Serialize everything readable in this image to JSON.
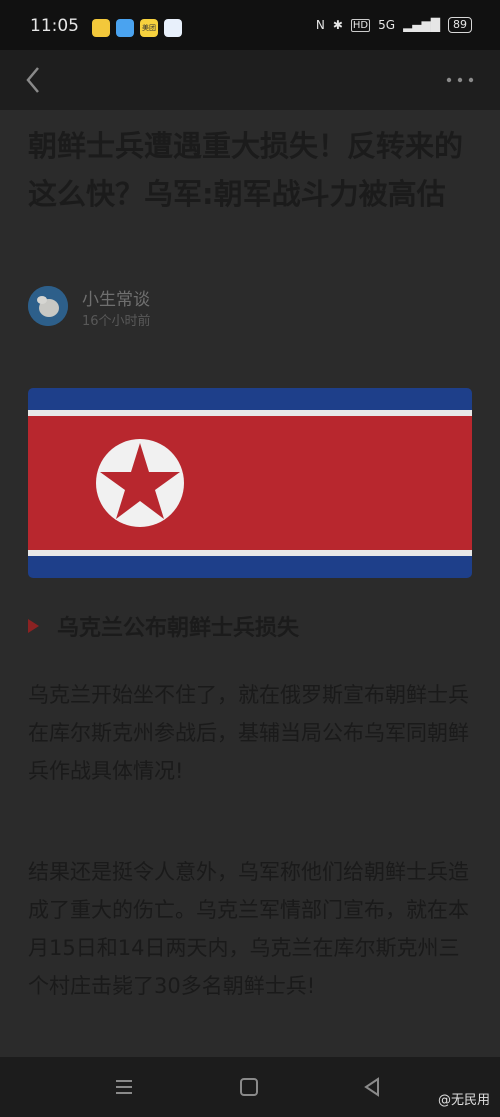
{
  "status": {
    "time": "11:05",
    "network": "5G",
    "battery": "89",
    "app_icons": [
      {
        "name": "app-icon-yellow",
        "color": "#f3c83b",
        "label": ""
      },
      {
        "name": "app-icon-blue",
        "color": "#4aa3f0",
        "label": ""
      },
      {
        "name": "app-icon-meituan",
        "color": "#f7d23e",
        "label": "美团"
      },
      {
        "name": "app-icon-white",
        "color": "#e8f0fb",
        "label": ""
      }
    ]
  },
  "article": {
    "title": "朝鲜士兵遭遇重大损失！反转来的这么快？乌军:朝军战斗力被高估",
    "author": "小生常谈",
    "time": "16个小时前",
    "section": "乌克兰公布朝鲜士兵损失",
    "paragraphs": [
      "乌克兰开始坐不住了，就在俄罗斯宣布朝鲜士兵在库尔斯克州参战后，基辅当局公布乌军同朝鲜兵作战具体情况!",
      "结果还是挺令人意外，乌军称他们给朝鲜士兵造成了重大的伤亡。乌克兰军情部门宣布，就在本月15日和14日两天内，乌克兰在库尔斯克州三个村庄击毙了30多名朝鲜士兵!"
    ]
  },
  "watermark": "@无民用",
  "colors": {
    "accent": "#8b2222",
    "flag_red": "#b8272e",
    "flag_blue": "#1e3f8a"
  }
}
